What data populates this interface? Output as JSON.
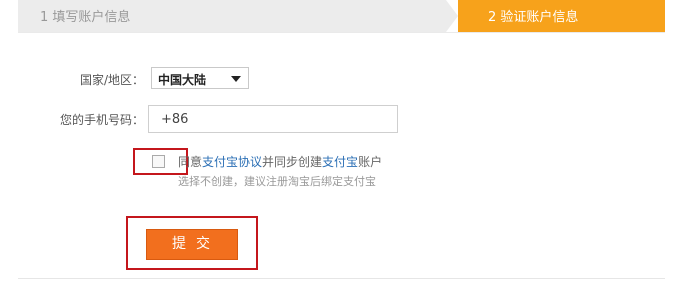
{
  "steps": [
    {
      "label": "1 填写账户信息",
      "state": "done"
    },
    {
      "label": "2 验证账户信息",
      "state": "active"
    }
  ],
  "form": {
    "country_label": "国家/地区：",
    "country_value": "中国大陆",
    "phone_label": "您的手机号码：",
    "phone_value": "+86",
    "agree_prefix": "同意",
    "agree_link1": "支付宝协议",
    "agree_middle": "并同步创建",
    "agree_link2": "支付宝",
    "agree_suffix": "账户",
    "hint": "选择不创建，建议注册淘宝后绑定支付宝",
    "checkbox_checked": false,
    "submit_label": "提交"
  },
  "colors": {
    "step_active": "#f7a21b",
    "submit": "#f26f1e",
    "link": "#2b6fb5",
    "highlight": "#c4161c"
  }
}
